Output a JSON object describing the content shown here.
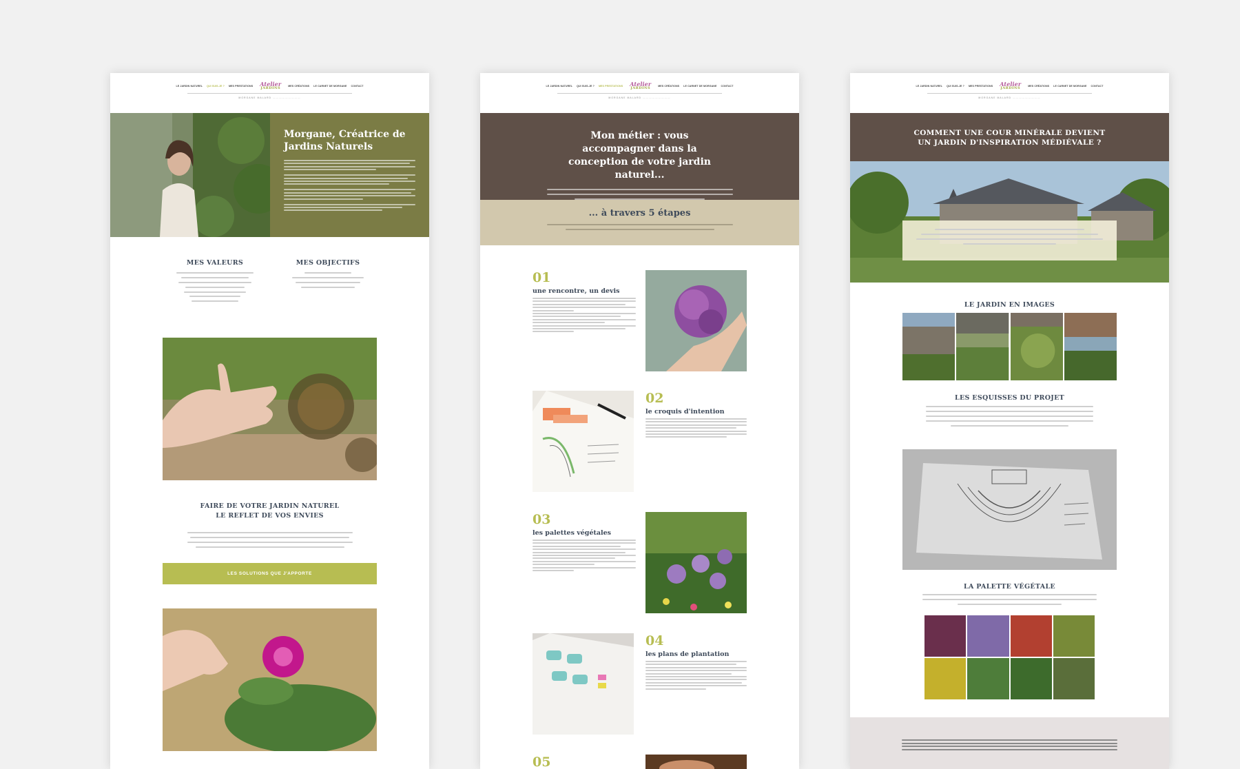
{
  "colors": {
    "olive": "#7b7c45",
    "lime": "#b7bd52",
    "brown": "#5f5048",
    "beige": "#d2c8ad",
    "navy": "#3e4a5a",
    "purple": "#b55a9b",
    "greyband": "#e6e1e1"
  },
  "brand": {
    "logo_top": "Atelier",
    "logo_bottom": "JARDINS",
    "subtitle": "MORGANE MALARD"
  },
  "nav": {
    "p1": {
      "left": [
        "LE JARDIN NATUREL",
        "QUI SUIS-JE ?",
        "MES PRESTATIONS"
      ],
      "right": [
        "MES CRÉATIONS",
        "LE CARNET DE MORGANE",
        "CONTACT"
      ]
    },
    "p2": {
      "left": [
        "LE JARDIN NATUREL",
        "QUI SUIS-JE ?",
        "MES PRESTATIONS"
      ],
      "right": [
        "MES CRÉATIONS",
        "LE CARNET DE MORGANE",
        "CONTACT"
      ]
    },
    "p3": {
      "left": [
        "LE JARDIN NATUREL",
        "QUI SUIS-JE ?",
        "MES PRESTATIONS"
      ],
      "right": [
        "MES CRÉATIONS",
        "LE CARNET DE MORGANE",
        "CONTACT"
      ]
    }
  },
  "page1": {
    "hero_title": "Morgane, Créatrice de Jardins Naturels",
    "values_title": "MES VALEURS",
    "objectives_title": "MES OBJECTIFS",
    "section_title_1": "FAIRE DE VOTRE JARDIN NATUREL",
    "section_title_2": "LE REFLET DE VOS ENVIES",
    "cta": "LES SOLUTIONS QUE J'APPORTE"
  },
  "page2": {
    "hero_title": "Mon métier : vous accompagner dans la conception de votre jardin naturel...",
    "band_title": "... à travers 5 étapes",
    "steps": [
      {
        "num": "01",
        "title": "une rencontre, un devis"
      },
      {
        "num": "02",
        "title": "le croquis d'intention"
      },
      {
        "num": "03",
        "title": "les palettes végétales"
      },
      {
        "num": "04",
        "title": "les plans de plantation"
      },
      {
        "num": "05",
        "title": ""
      }
    ]
  },
  "page3": {
    "hero_title": "COMMENT UNE COUR MINÉRALE DEVIENT UN JARDIN D'INSPIRATION MÉDIÉVALE ?",
    "gallery_title": "LE JARDIN EN IMAGES",
    "sketch_title": "LES ESQUISSES DU PROJET",
    "palette_title": "LA PALETTE VÉGÉTALE"
  }
}
